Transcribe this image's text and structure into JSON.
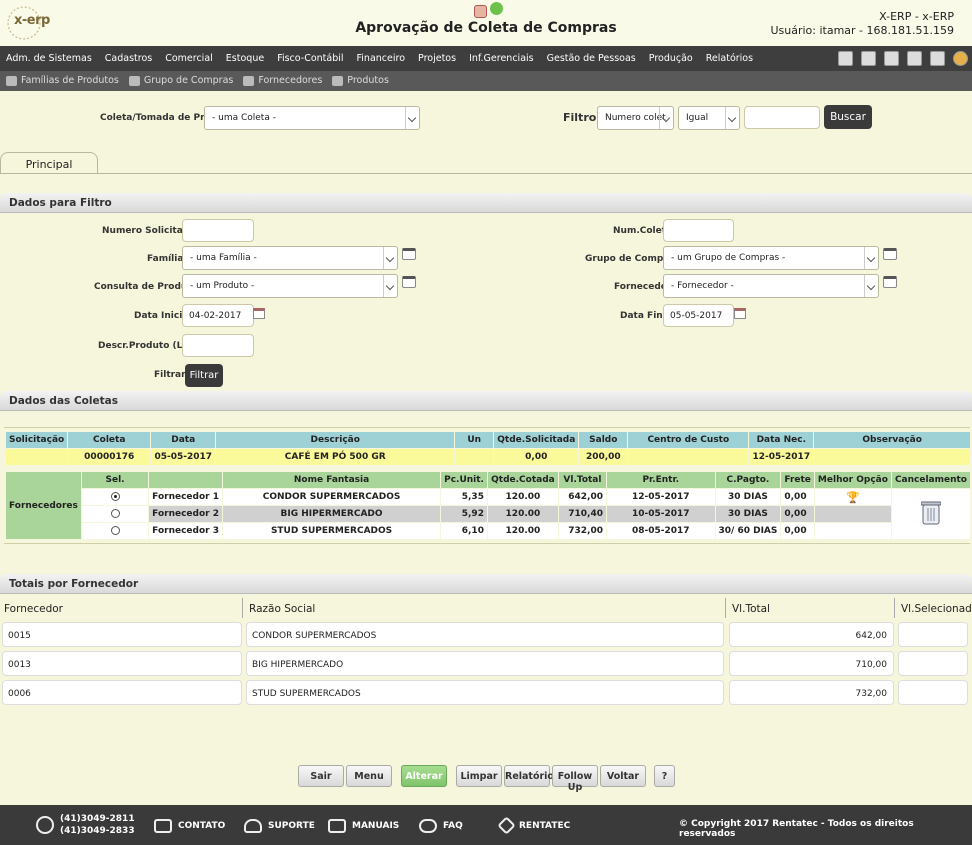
{
  "header": {
    "logo_text": "x-erp",
    "title": "Aprovação de Coleta de Compras",
    "system": "X-ERP - x-ERP",
    "user": "Usuário: itamar - 168.181.51.159"
  },
  "menu": [
    "Adm. de Sistemas",
    "Cadastros",
    "Comercial",
    "Estoque",
    "Fisco-Contábil",
    "Financeiro",
    "Projetos",
    "Inf.Gerenciais",
    "Gestão de Pessoas",
    "Produção",
    "Relatórios"
  ],
  "submenu": [
    "Famílias de Produtos",
    "Grupo de Compras",
    "Fornecedores",
    "Produtos"
  ],
  "search": {
    "coleta_label": "Coleta/Tomada de Precos",
    "coleta_value": "- uma Coleta -",
    "filtro_label": "Filtro:",
    "filtro_field": "Numero colet",
    "filtro_op": "Igual",
    "filtro_value": "",
    "buscar": "Buscar"
  },
  "tabs": [
    "Principal"
  ],
  "filter": {
    "section": "Dados para Filtro",
    "numero_solicitacao_label": "Numero Solicitacao",
    "num_coleta_label": "Num.Coleta",
    "familias_label": "Famílias",
    "familias_value": "- uma Família -",
    "grupo_label": "Grupo de Compras",
    "grupo_value": "- um Grupo de Compras -",
    "consulta_label": "Consulta de Produtos",
    "consulta_value": "- um Produto -",
    "fornecedor_label": "Fornecedor",
    "fornecedor_value": "- Fornecedor -",
    "data_inicial_label": "Data Inicial",
    "data_inicial_value": "04-02-2017",
    "data_final_label": "Data Final",
    "data_final_value": "05-05-2017",
    "descr_label": "Descr.Produto (LIKE)",
    "filtrar_label": "Filtrar",
    "filtrar_button": "Filtrar"
  },
  "coletas": {
    "section": "Dados das Coletas",
    "headers": [
      "Solicitação",
      "Coleta",
      "Data",
      "Descrição",
      "Un",
      "Qtde.Solicitada",
      "Saldo",
      "Centro de Custo",
      "Data Nec.",
      "Observação"
    ],
    "row": [
      "",
      "00000176",
      "05-05-2017",
      "CAFÉ EM PÓ 500 GR",
      "",
      "0,00",
      "200,00",
      "",
      "12-05-2017",
      ""
    ],
    "fornecedores_label": "Fornecedores",
    "forn_headers": [
      "Sel.",
      "",
      "Nome Fantasia",
      "Pc.Unit.",
      "Qtde.Cotada",
      "Vl.Total",
      "Pr.Entr.",
      "C.Pagto.",
      "Frete",
      "Melhor Opção",
      "Cancelamento"
    ],
    "forn_rows": [
      [
        "Fornecedor 1",
        "CONDOR SUPERMERCADOS",
        "5,35",
        "120.00",
        "642,00",
        "12-05-2017",
        "30 DIAS",
        "0,00"
      ],
      [
        "Fornecedor 2",
        "BIG HIPERMERCADO",
        "5,92",
        "120.00",
        "710,40",
        "10-05-2017",
        "30 DIAS",
        "0,00"
      ],
      [
        "Fornecedor 3",
        "STUD SUPERMERCADOS",
        "6,10",
        "120.00",
        "732,00",
        "08-05-2017",
        "30/ 60 DIAS",
        "0,00"
      ]
    ],
    "selected_index": 0
  },
  "totais": {
    "section": "Totais por Fornecedor",
    "headers": [
      "Fornecedor",
      "Razão Social",
      "Vl.Total",
      "Vl.Selecionado"
    ],
    "rows": [
      [
        "0015",
        "CONDOR SUPERMERCADOS",
        "642,00",
        ""
      ],
      [
        "0013",
        "BIG HIPERMERCADO",
        "710,00",
        ""
      ],
      [
        "0006",
        "STUD SUPERMERCADOS",
        "732,00",
        ""
      ]
    ]
  },
  "buttons": [
    "Sair",
    "Menu",
    "Alterar",
    "Limpar",
    "Relatório",
    "Follow Up",
    "Voltar",
    "?"
  ],
  "footer": {
    "phone1": "(41)3049-2811",
    "phone2": "(41)3049-2833",
    "contato": "CONTATO",
    "suporte": "SUPORTE",
    "manuais": "MANUAIS",
    "faq": "FAQ",
    "rentatec": "RENTATEC",
    "copyright": "© Copyright 2017 Rentatec - Todos os direitos reservados"
  },
  "colors": {
    "accent_green": "#8fd07a",
    "teal_header": "#9ed1d6",
    "yellow_row": "#fafa9a",
    "dark_bar": "#3e3e3e"
  }
}
